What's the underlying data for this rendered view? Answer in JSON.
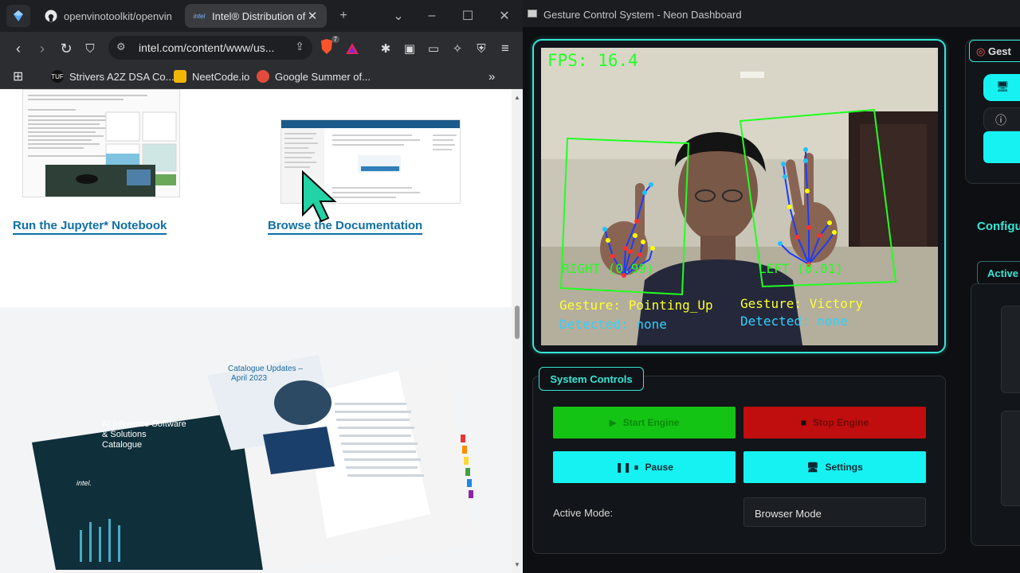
{
  "browser": {
    "tabs": [
      {
        "title": "openvinotoolkit/openvino"
      },
      {
        "title": "Intel® Distribution of"
      }
    ],
    "url": "intel.com/content/www/us...",
    "brave_badge_count": "7",
    "bookmarks": [
      {
        "label": "Strivers A2Z DSA Co..."
      },
      {
        "label": "NeetCode.io"
      },
      {
        "label": "Google Summer of..."
      }
    ],
    "page": {
      "link_notebook": "Run the Jupyter* Notebook",
      "link_docs": "Browse the Documentation"
    }
  },
  "dashboard": {
    "window_title": "Gesture Control System - Neon Dashboard",
    "video": {
      "fps_text": "FPS: 16.4",
      "right_hand_label": "RIGHT (0.99)",
      "left_hand_label": "LEFT (0.01)",
      "gesture_right": "Gesture: Pointing_Up",
      "detected_right": "Detected: none",
      "gesture_left": "Gesture: Victory",
      "detected_left": "Detected: none"
    },
    "controls": {
      "section_title": "System Controls",
      "start_label": "Start Engine",
      "stop_label": "Stop Engine",
      "pause_label": "Pause",
      "settings_label": "Settings",
      "mode_label": "Active Mode:",
      "mode_value": "Browser Mode"
    },
    "side": {
      "tab_label": "Gest",
      "config_heading": "Configu",
      "active_tab": "Active"
    },
    "colors": {
      "neon": "#36e6d6",
      "start": "#14c414",
      "stop": "#c00d0d",
      "cyan_button": "#16f2f2"
    }
  }
}
